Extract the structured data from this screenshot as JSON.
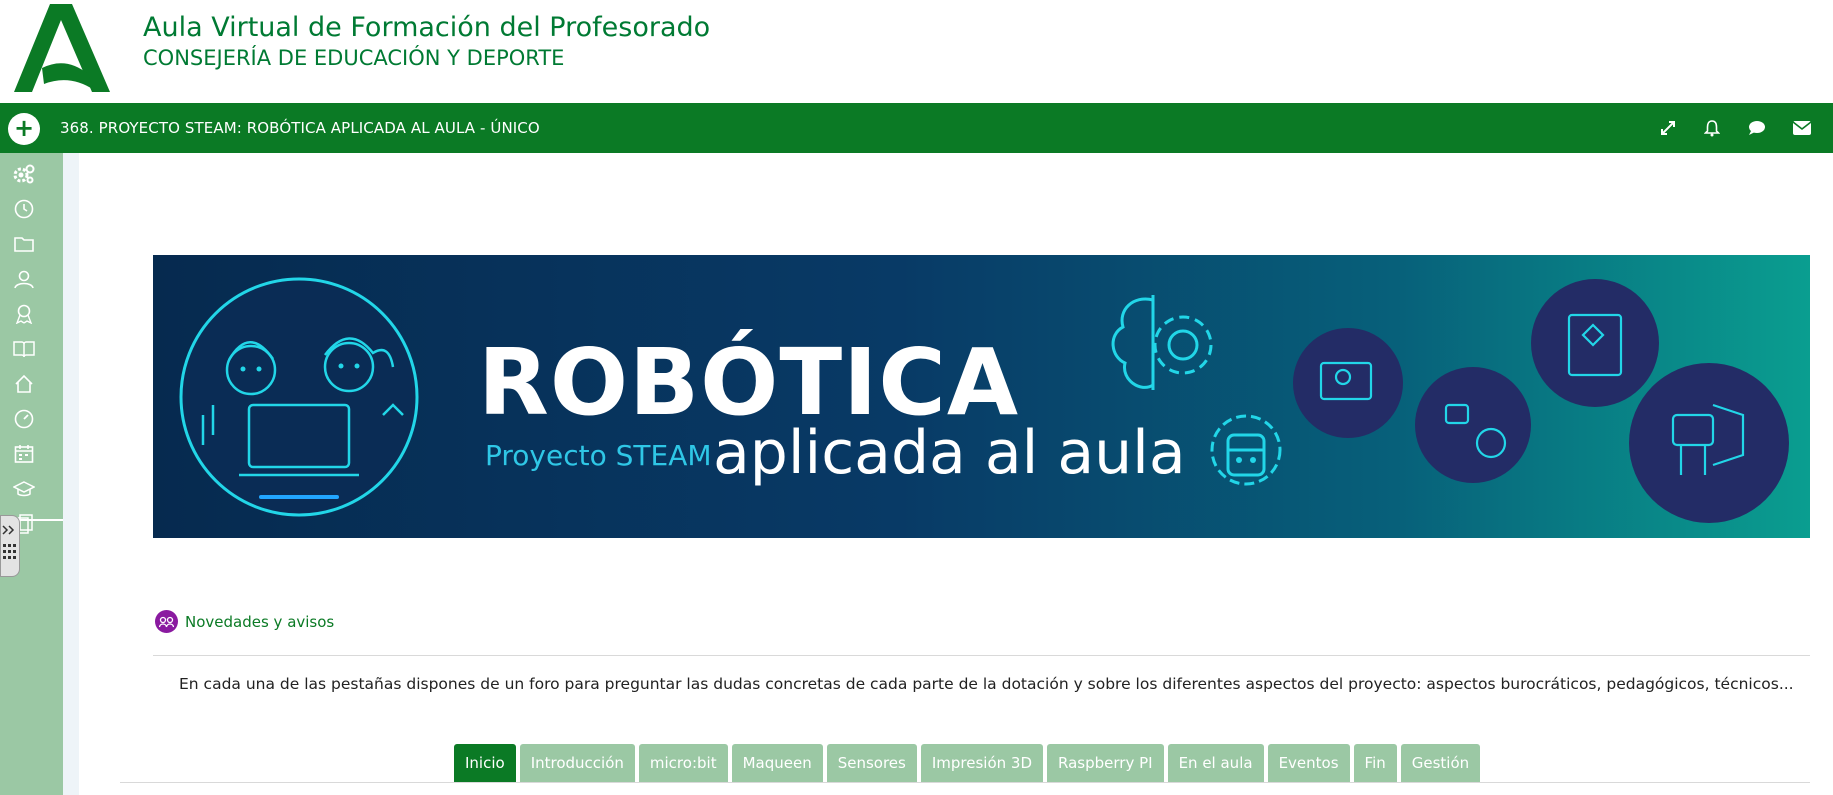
{
  "header": {
    "title": "Aula Virtual de Formación del Profesorado",
    "subtitle": "CONSEJERÍA DE EDUCACIÓN Y DEPORTE",
    "logo_icon": "junta-andalucia-logo",
    "brand_color": "#007a33"
  },
  "navbar": {
    "add_icon": "plus-circle-icon",
    "course_title": "368. PROYECTO STEAM: ROBÓTICA APLICADA AL AULA - ÚNICO",
    "background": "#0b7a25",
    "icons": [
      "fullscreen-icon",
      "bell-icon",
      "chat-icon",
      "envelope-icon"
    ]
  },
  "sidebar": {
    "background": "#9bc8a4",
    "items": [
      "gears-icon",
      "clock-icon",
      "folder-icon",
      "users-icon",
      "award-icon",
      "book-icon",
      "home-icon",
      "dashboard-icon",
      "calendar-icon",
      "graduation-cap-icon",
      "clipboard-icon"
    ]
  },
  "banner": {
    "title": "ROBÓTICA",
    "subtitle_small": "Proyecto STEAM",
    "subtitle_large": "aplicada al aula"
  },
  "news": {
    "label": "Novedades y avisos",
    "icon": "forum-icon"
  },
  "summary": "En cada una de las pestañas dispones de un foro para preguntar las dudas concretas de cada parte de la dotación y sobre los diferentes aspectos del proyecto: aspectos burocráticos, pedagógicos, técnicos...",
  "tabs": [
    {
      "label": "Inicio",
      "active": true
    },
    {
      "label": "Introducción",
      "active": false
    },
    {
      "label": "micro:bit",
      "active": false
    },
    {
      "label": "Maqueen",
      "active": false
    },
    {
      "label": "Sensores",
      "active": false
    },
    {
      "label": "Impresión 3D",
      "active": false
    },
    {
      "label": "Raspberry PI",
      "active": false
    },
    {
      "label": "En el aula",
      "active": false
    },
    {
      "label": "Eventos",
      "active": false
    },
    {
      "label": "Fin",
      "active": false
    },
    {
      "label": "Gestión",
      "active": false
    }
  ]
}
